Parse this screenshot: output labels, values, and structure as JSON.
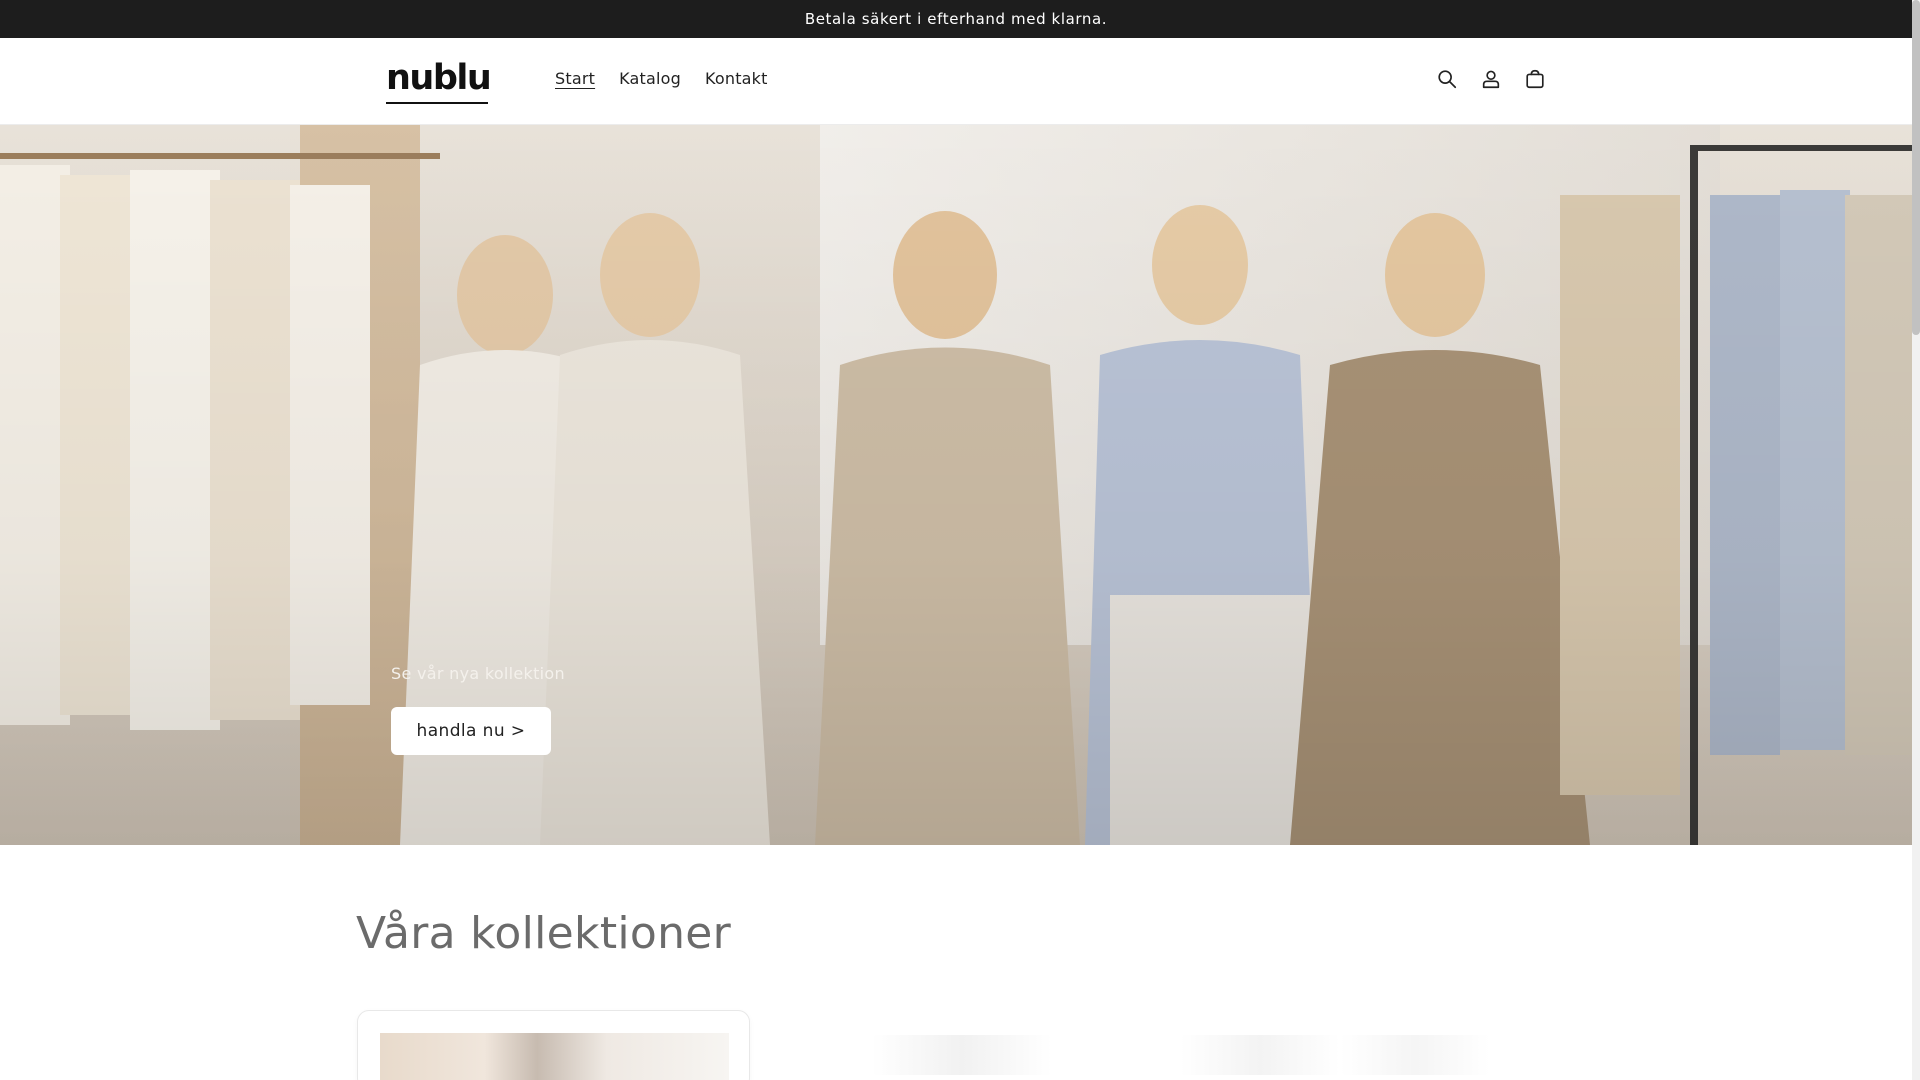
{
  "announcement": {
    "text": "Betala säkert i efterhand med klarna."
  },
  "header": {
    "logo_text": "nublu",
    "nav": [
      {
        "label": "Start",
        "active": true
      },
      {
        "label": "Katalog",
        "active": false
      },
      {
        "label": "Kontakt",
        "active": false
      }
    ],
    "icons": [
      "search-icon",
      "account-icon",
      "cart-icon"
    ]
  },
  "hero": {
    "subtitle": "Se vår nya kollektion",
    "button_label": "handla nu >"
  },
  "collections": {
    "title": "Våra kollektioner"
  },
  "colors": {
    "announcement_bg": "#1d1d1d",
    "accent": "#ffffff",
    "heading": "#6b6b6b"
  }
}
